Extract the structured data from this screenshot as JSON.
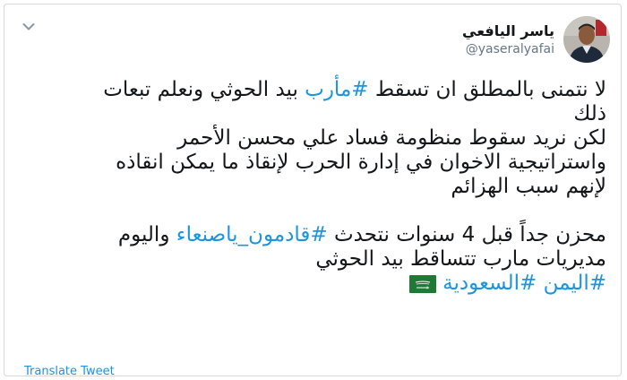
{
  "author": {
    "display_name": "ياسر اليافعي",
    "handle": "@yaseralyafai"
  },
  "tweet": {
    "line1_pre": "لا نتمنى بالمطلق ان تسقط ",
    "line1_hashtag": "#مأرب",
    "line1_post": " بيد الحوثي ونعلم تبعات",
    "line2": "ذلك",
    "line3": "لكن نريد سقوط منظومة فساد علي محسن الأحمر",
    "line4": "واستراتيجية الاخوان في إدارة الحرب لإنقاذ ما يمكن انقاذه",
    "line5": "لإنهم سبب الهزائم",
    "line6_pre": "محزن جداً قبل 4 سنوات نتحدث ",
    "line6_hashtag": "#قادمون_ياصنعاء",
    "line6_post": " واليوم",
    "line7": "مديريات مارب تتساقط بيد الحوثي",
    "hashtag_yemen": "#اليمن",
    "hashtag_saudi": "#السعودية",
    "flag_emoji": "saudi-flag"
  },
  "actions": {
    "translate_label": "Translate Tweet"
  },
  "icons": {
    "menu": "chevron-down-icon"
  },
  "colors": {
    "link": "#1b95e0",
    "text": "#14171a",
    "secondary": "#657786",
    "border": "#d6d9db",
    "flag_green": "#1e7a34"
  }
}
